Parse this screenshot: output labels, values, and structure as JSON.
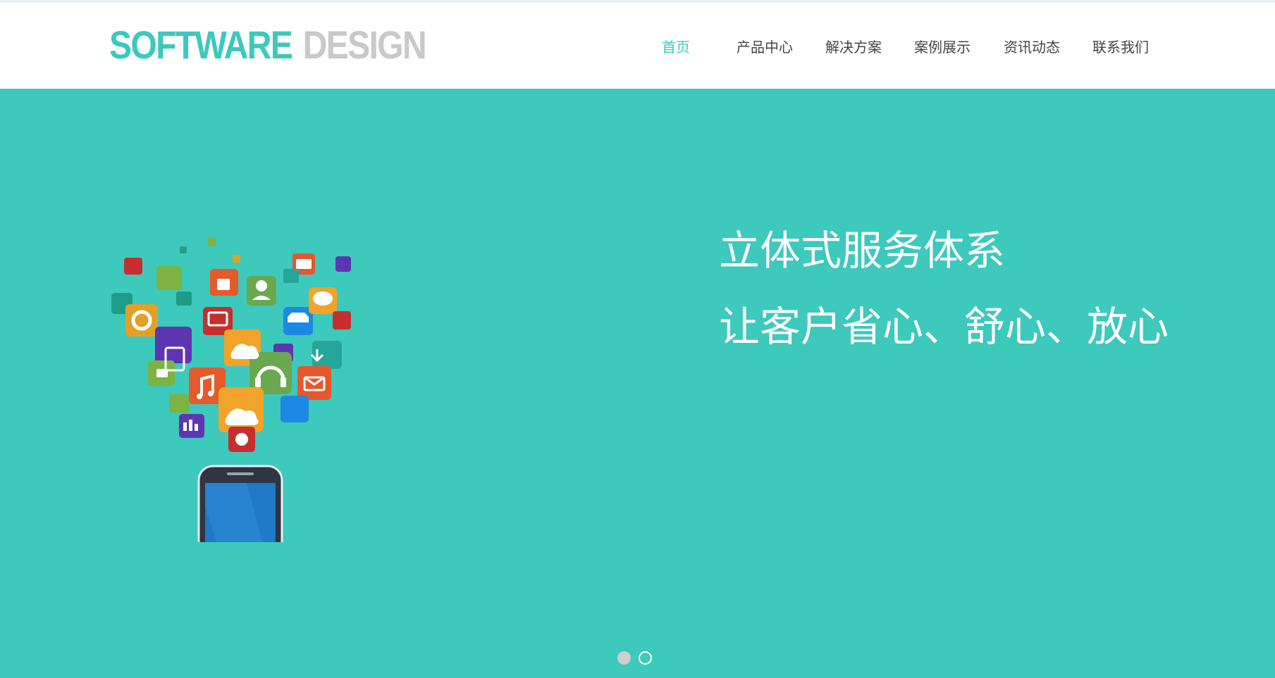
{
  "logo": {
    "part1": "SOFTWARE",
    "part2": "DESIGN",
    "color_primary": "#3cc9bc",
    "color_secondary": "#c9c9c9"
  },
  "nav": {
    "items": [
      {
        "label": "首页",
        "active": true
      },
      {
        "label": "产品中心",
        "active": false
      },
      {
        "label": "解决方案",
        "active": false
      },
      {
        "label": "案例展示",
        "active": false
      },
      {
        "label": "资讯动态",
        "active": false
      },
      {
        "label": "联系我们",
        "active": false
      }
    ],
    "active_color": "#3cc9bc",
    "color": "#444444"
  },
  "hero": {
    "background": "#3dc9bb",
    "line1": "立体式服务体系",
    "line2": "让客户省心、舒心、放心",
    "illustration": "smartphone-with-app-icons-illustration"
  },
  "carousel": {
    "slides": 2,
    "current": 1
  }
}
